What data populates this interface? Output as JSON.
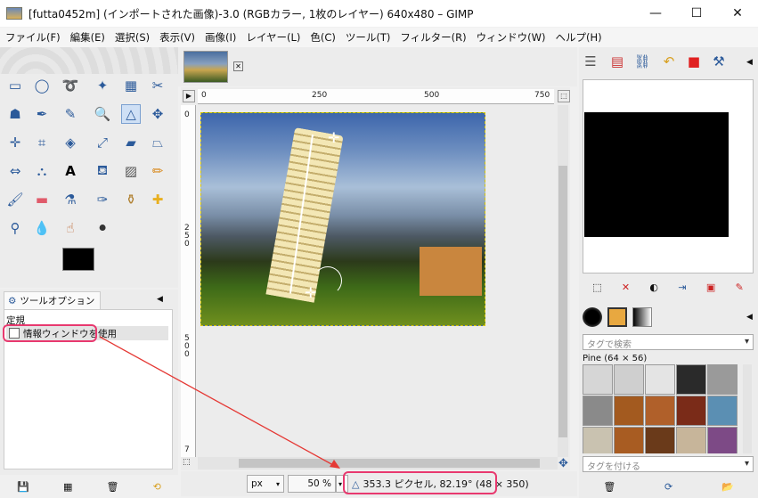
{
  "window": {
    "title": "[futta0452m] (インポートされた画像)-3.0 (RGBカラー, 1枚のレイヤー) 640x480 – GIMP",
    "minimize": "—",
    "maximize": "☐",
    "close": "✕"
  },
  "menu": [
    "ファイル(F)",
    "編集(E)",
    "選択(S)",
    "表示(V)",
    "画像(I)",
    "レイヤー(L)",
    "色(C)",
    "ツール(T)",
    "フィルター(R)",
    "ウィンドウ(W)",
    "ヘルプ(H)"
  ],
  "tool_options": {
    "tab_label": "ツールオプション",
    "section_label": "定規",
    "checkbox_label": "情報ウィンドウを使用"
  },
  "rulers": {
    "h": [
      "0",
      "250",
      "500",
      "750"
    ],
    "v": [
      "0",
      "250",
      "500",
      "7"
    ]
  },
  "status": {
    "unit": "px",
    "zoom": "50 %",
    "measurement": "353.3 ピクセル, 82.19° (48 × 350)"
  },
  "patterns": {
    "tag_search_placeholder": "タグで検索",
    "selected_name": "Pine (64 × 56)",
    "tag_assign_placeholder": "タグを付ける",
    "swatches": [
      "#d6d6d6",
      "#cfcfcf",
      "#e4e4e4",
      "#2a2a2a",
      "#9a9a9a",
      "#8a8a8a",
      "#a35a1f",
      "#b0602a",
      "#7a2b18",
      "#5b8fb3",
      "#c9c2b0",
      "#a85c22",
      "#6a3a1a",
      "#c7b59a",
      "#7d4a86",
      "#e5b04d",
      "#e2a955",
      "#d9b8a8",
      "#5d7fbf",
      "#7a6ab5"
    ]
  },
  "colors": {
    "highlight": "#e8396f",
    "arrow": "#e53935"
  }
}
